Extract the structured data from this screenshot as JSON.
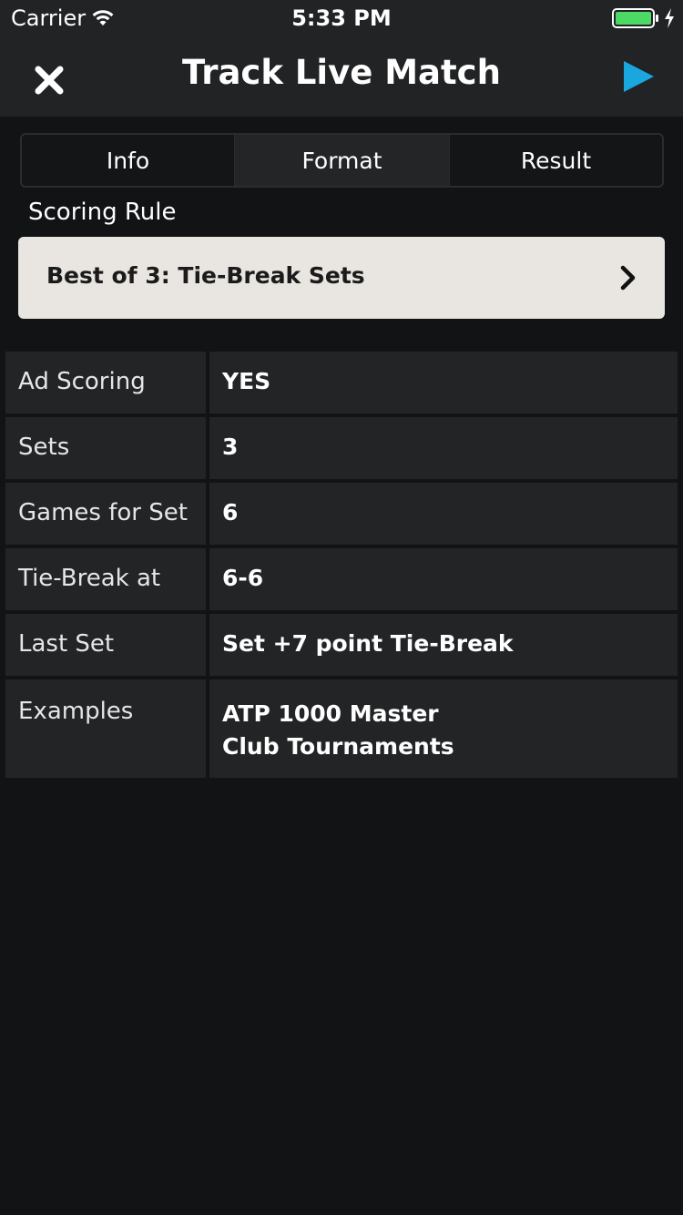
{
  "status_bar": {
    "carrier": "Carrier",
    "time": "5:33 PM",
    "battery_color": "#4cd964"
  },
  "nav": {
    "title": "Track Live Match",
    "close_icon": "close-icon",
    "play_icon": "play-icon",
    "accent": "#1aa7e0"
  },
  "tabs": [
    {
      "label": "Info"
    },
    {
      "label": "Format"
    },
    {
      "label": "Result"
    }
  ],
  "scoring": {
    "section_label": "Scoring Rule",
    "selected_rule": "Best of 3: Tie-Break Sets"
  },
  "format_rows": [
    {
      "label": "Ad Scoring",
      "value": "YES"
    },
    {
      "label": "Sets",
      "value": "3"
    },
    {
      "label": "Games for Set",
      "value": "6"
    },
    {
      "label": "Tie-Break at",
      "value": "6-6"
    },
    {
      "label": "Last Set",
      "value": "Set +7 point Tie-Break"
    },
    {
      "label": "Examples",
      "values": [
        "ATP 1000 Master",
        "Club Tournaments"
      ]
    }
  ]
}
